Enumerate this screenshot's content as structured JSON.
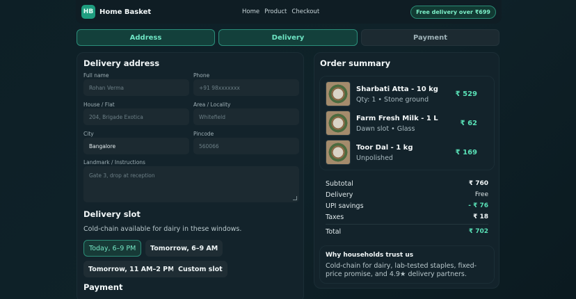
{
  "brand": {
    "logo": "HB",
    "name": "Home Basket"
  },
  "nav": [
    "Home",
    "Product",
    "Checkout"
  ],
  "promo": "Free delivery over ₹699",
  "steps": [
    "Address",
    "Delivery",
    "Payment"
  ],
  "address": {
    "title": "Delivery address",
    "full_name": {
      "label": "Full name",
      "placeholder": "Rohan Verma"
    },
    "phone": {
      "label": "Phone",
      "placeholder": "+91 98xxxxxxx"
    },
    "house": {
      "label": "House / Flat",
      "placeholder": "204, Brigade Exotica"
    },
    "area": {
      "label": "Area / Locality",
      "placeholder": "Whitefield"
    },
    "city": {
      "label": "City",
      "value": "Bangalore"
    },
    "pincode": {
      "label": "Pincode",
      "placeholder": "560066"
    },
    "landmark": {
      "label": "Landmark / Instructions",
      "placeholder": "Gate 3, drop at reception"
    }
  },
  "slot": {
    "title": "Delivery slot",
    "note": "Cold-chain available for dairy in these windows.",
    "options": [
      "Today, 6–9 PM",
      "Tomorrow, 6–9 AM",
      "Tomorrow, 11 AM–2 PM",
      "Custom slot"
    ]
  },
  "payment": {
    "title": "Payment"
  },
  "summary": {
    "title": "Order summary",
    "items": [
      {
        "name": "Sharbati Atta - 10 kg",
        "sub": "Qty: 1 • Stone ground",
        "price": "₹ 529"
      },
      {
        "name": "Farm Fresh Milk - 1 L",
        "sub": "Dawn slot • Glass",
        "price": "₹ 62"
      },
      {
        "name": "Toor Dal - 1 kg",
        "sub": "Unpolished",
        "price": "₹ 169"
      }
    ],
    "subtotal": {
      "label": "Subtotal",
      "value": "₹ 760"
    },
    "delivery": {
      "label": "Delivery",
      "value": "Free"
    },
    "upi": {
      "label": "UPI savings",
      "value": "- ₹ 76"
    },
    "taxes": {
      "label": "Taxes",
      "value": "₹ 18"
    },
    "total": {
      "label": "Total",
      "value": "₹ 702"
    }
  },
  "trust": {
    "title": "Why households trust us",
    "text": "Cold-chain for dairy, lab-tested staples, fixed-price promise, and 4.9★ delivery partners."
  }
}
